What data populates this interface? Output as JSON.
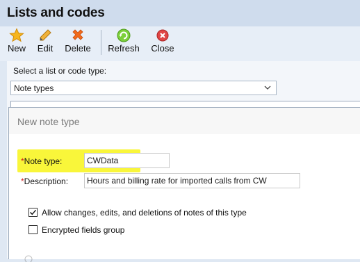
{
  "window": {
    "title": "Lists and codes"
  },
  "toolbar": {
    "new_label": "New",
    "edit_label": "Edit",
    "delete_label": "Delete",
    "refresh_label": "Refresh",
    "close_label": "Close"
  },
  "selector": {
    "label": "Select a list or code type:",
    "value": "Note types"
  },
  "dialog": {
    "title": "New note type",
    "required_marker": "*",
    "note_type_label": "Note type:",
    "note_type_value": "CWData",
    "description_label": "Description:",
    "description_value": "Hours and billing rate for imported calls from CW",
    "allow_changes_label": "Allow changes, edits, and deletions of notes of this type",
    "allow_changes_checked": true,
    "encrypted_label": "Encrypted fields group",
    "encrypted_checked": false
  },
  "colors": {
    "highlight": "#f9f63a",
    "required": "#d42020",
    "title_bar": "#cfdced",
    "toolbar": "#e7eef7"
  },
  "icons": {
    "new": "star-icon",
    "edit": "pencil-icon",
    "delete": "x-icon",
    "refresh": "refresh-icon",
    "close": "close-icon",
    "dropdown": "chevron-down-icon"
  }
}
